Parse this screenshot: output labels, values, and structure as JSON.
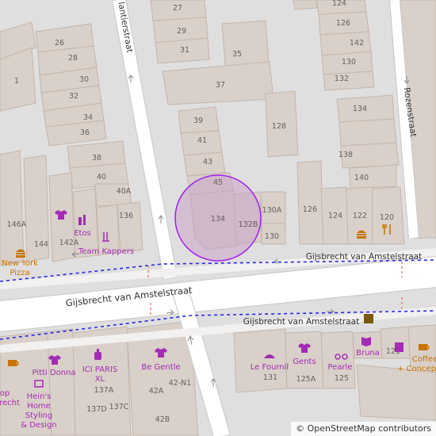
{
  "streets": {
    "main_top": "Gijsbrecht van Amstelstraat",
    "main_center": "Gijsbrecht van Amstelstraat",
    "main_bottom": "Gijsbrecht van Amstelstraat",
    "top_left": "lantierstraat",
    "rozen": "Rozenstraat"
  },
  "house_numbers": [
    "27",
    "29",
    "31",
    "35",
    "37",
    "26",
    "28",
    "30",
    "32",
    "34",
    "36",
    "38",
    "40",
    "40A",
    "39",
    "41",
    "43",
    "45",
    "124",
    "126",
    "128",
    "130",
    "132",
    "134",
    "138",
    "140",
    "142",
    "144",
    "146A",
    "142A",
    "136",
    "1",
    "134",
    "132B",
    "130A",
    "130",
    "126",
    "124",
    "122",
    "120",
    "137A",
    "137D",
    "137C",
    "42A",
    "42-N1",
    "42B",
    "131",
    "125A",
    "125",
    "121"
  ],
  "pois": {
    "etos": "Etos",
    "team_kappers": "Team Kappers",
    "new_york_pizza_1": "New York",
    "new_york_pizza_2": "Pizza",
    "pitti_donna": "Pitti Donna",
    "ici_paris_1": "ICI PARIS",
    "ici_paris_2": "XL",
    "be_gentle": "Be Gentle",
    "le_fournil": "Le Fournil",
    "gents": "Gents",
    "pearle": "Pearle",
    "bruna": "Bruna",
    "coffee_1": "Coffee",
    "coffee_2": "+ Concepts",
    "heins_1": "Hein's",
    "heins_2": "Home",
    "heins_3": "Styling",
    "heins_4": "& Design",
    "op_1": "op",
    "op_2": "recht"
  },
  "colors": {
    "background": "#e0dfdf",
    "building": "#d9d0c9",
    "building_outline": "#c4b6ab",
    "road": "#ffffff",
    "road_outline": "#c8c6c4",
    "route": "#2727ee",
    "marker_fill": "#c8a2c8",
    "marker_stroke": "#a020f0",
    "poi_label": "#a32bb6",
    "food_icon": "#c77400"
  },
  "attribution": {
    "symbol": "©",
    "text": "OpenStreetMap contributors"
  }
}
